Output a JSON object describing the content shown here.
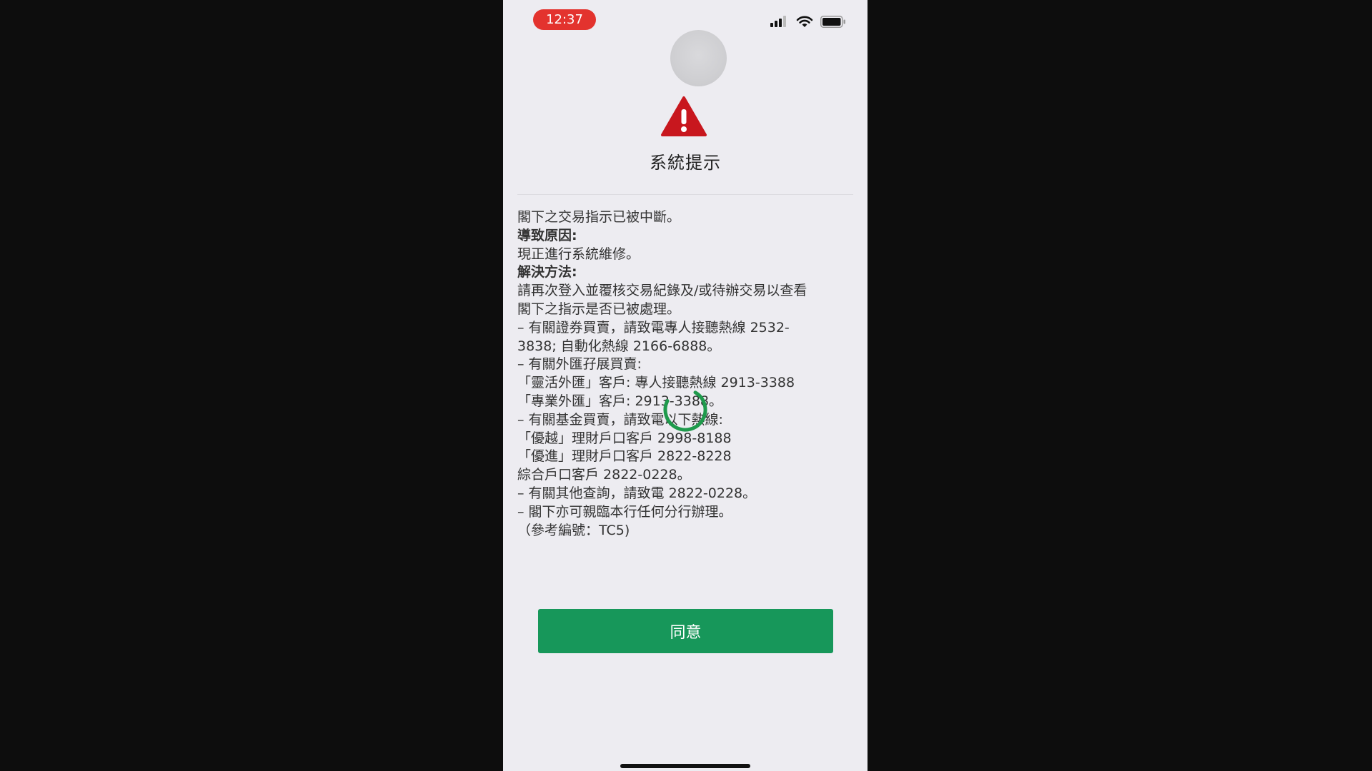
{
  "status_bar": {
    "time": "12:37",
    "icons": [
      "cellular-signal-icon",
      "wifi-icon",
      "battery-icon"
    ]
  },
  "dialog": {
    "icon": "warning-icon",
    "title": "系統提示",
    "lines": [
      {
        "text": "閣下之交易指示已被中斷。",
        "bold": false
      },
      {
        "text": "導致原因:",
        "bold": true
      },
      {
        "text": "現正進行系統維修。",
        "bold": false
      },
      {
        "text": "解決方法:",
        "bold": true
      },
      {
        "text": "請再次登入並覆核交易紀錄及/或待辦交易以查看",
        "bold": false
      },
      {
        "text": "閣下之指示是否已被處理。",
        "bold": false
      },
      {
        "text": "– 有關證券買賣，請致電專人接聽熱線 2532-",
        "bold": false
      },
      {
        "text": "3838; 自動化熱線 2166-6888。",
        "bold": false
      },
      {
        "text": "– 有關外匯孖展買賣:",
        "bold": false
      },
      {
        "text": "「靈活外匯」客戶: 專人接聽熱線 2913-3388",
        "bold": false
      },
      {
        "text": "「專業外匯」客戶: 2913-3388。",
        "bold": false
      },
      {
        "text": "– 有關基金買賣，請致電以下熱線:",
        "bold": false
      },
      {
        "text": "「優越」理財戶口客戶 2998-8188",
        "bold": false
      },
      {
        "text": "「優進」理財戶口客戶 2822-8228",
        "bold": false
      },
      {
        "text": "綜合戶口客戶 2822-0228。",
        "bold": false
      },
      {
        "text": "– 有關其他查詢，請致電 2822-0228。",
        "bold": false
      },
      {
        "text": "– 閣下亦可親臨本行任何分行辦理。",
        "bold": false
      },
      {
        "text": "（參考編號：TC5)",
        "bold": false
      }
    ],
    "agree_label": "同意"
  },
  "colors": {
    "time_pill": "#e3332e",
    "warning": "#c8171e",
    "button": "#17975a",
    "spinner": "#1f9a4c",
    "background": "#edecf1"
  }
}
